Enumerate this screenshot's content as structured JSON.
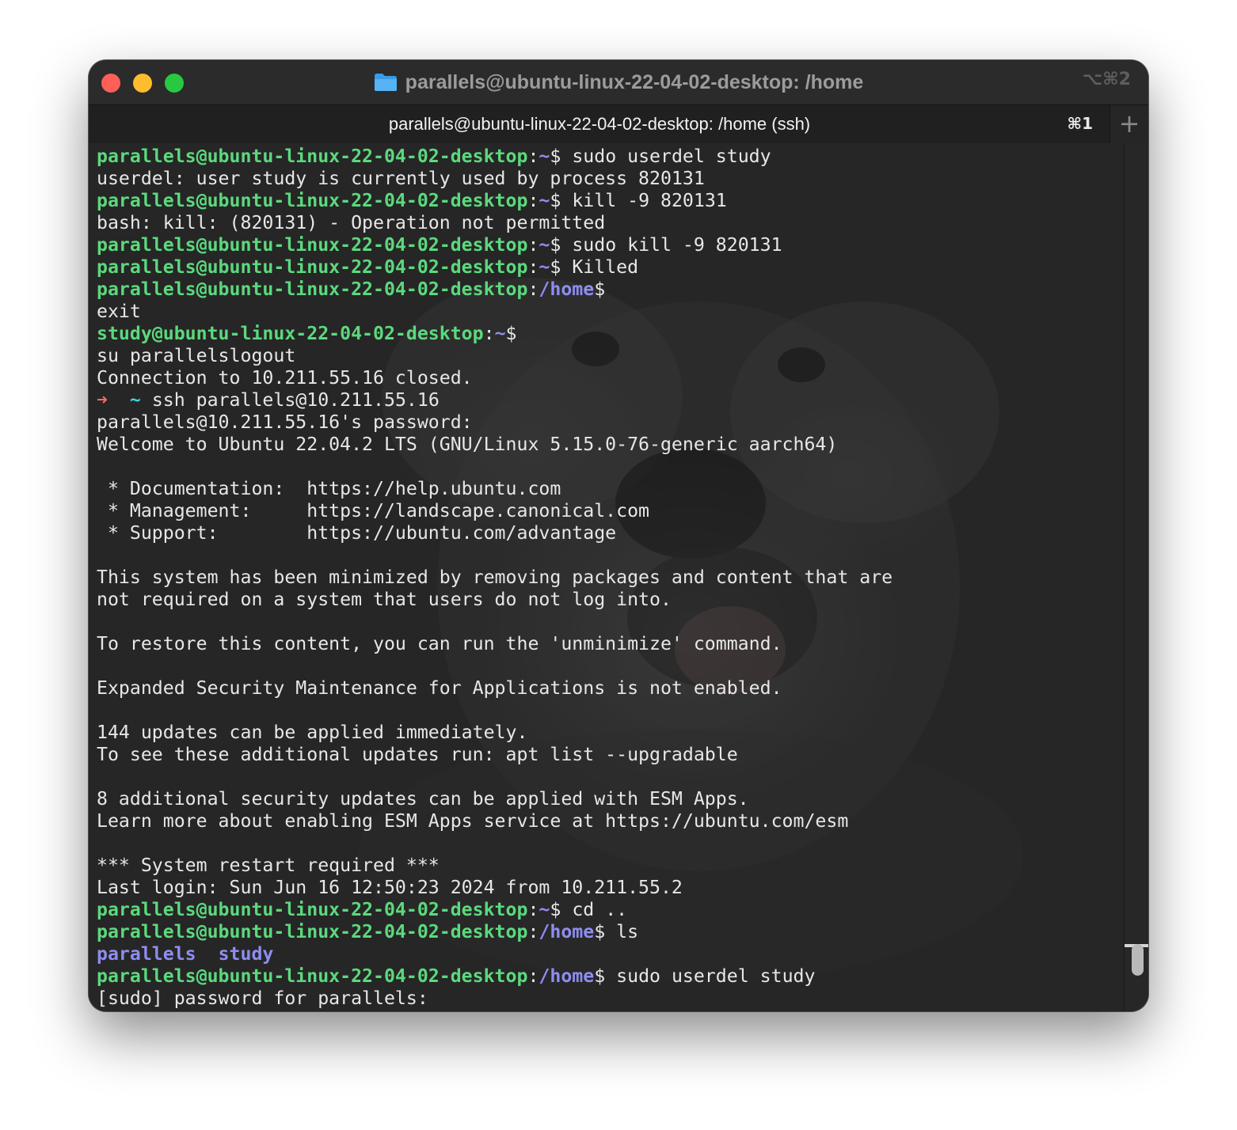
{
  "window": {
    "title": "parallels@ubuntu-linux-22-04-02-desktop: /home",
    "shortcut": "⌥⌘2"
  },
  "tab": {
    "title": "parallels@ubuntu-linux-22-04-02-desktop: /home (ssh)",
    "shortcut": "⌘1",
    "new_tab_label": "+"
  },
  "colors": {
    "prompt_user": "#5bd97d",
    "prompt_path": "#8e8df0",
    "zsh_tilde": "#3fd6e0",
    "zsh_arrow": "#f06a6a",
    "text": "#e7e7e7"
  },
  "terminal": {
    "lines": [
      {
        "user": "parallels@ubuntu-linux-22-04-02-desktop",
        "sep": ":",
        "path": "~",
        "sym": "$",
        "text": " sudo userdel study"
      },
      {
        "text": "userdel: user study is currently used by process 820131"
      },
      {
        "user": "parallels@ubuntu-linux-22-04-02-desktop",
        "sep": ":",
        "path": "~",
        "sym": "$",
        "text": " kill -9 820131"
      },
      {
        "text": "bash: kill: (820131) - Operation not permitted"
      },
      {
        "user": "parallels@ubuntu-linux-22-04-02-desktop",
        "sep": ":",
        "path": "~",
        "sym": "$",
        "text": " sudo kill -9 820131"
      },
      {
        "user": "parallels@ubuntu-linux-22-04-02-desktop",
        "sep": ":",
        "path": "~",
        "sym": "$",
        "text": " Killed"
      },
      {
        "user": "parallels@ubuntu-linux-22-04-02-desktop",
        "sep": ":",
        "path": "/home",
        "sym": "$",
        "text": ""
      },
      {
        "text": "exit"
      },
      {
        "user": "study@ubuntu-linux-22-04-02-desktop",
        "sep": ":",
        "path": "~",
        "sym": "$",
        "text": ""
      },
      {
        "text": "su parallelslogout"
      },
      {
        "text": "Connection to 10.211.55.16 closed."
      },
      {
        "zsh_arrow": "➜",
        "zsh_path": "~",
        "text": " ssh parallels@10.211.55.16"
      },
      {
        "text": "parallels@10.211.55.16's password:"
      },
      {
        "text": "Welcome to Ubuntu 22.04.2 LTS (GNU/Linux 5.15.0-76-generic aarch64)"
      },
      {
        "text": ""
      },
      {
        "text": " * Documentation:  https://help.ubuntu.com"
      },
      {
        "text": " * Management:     https://landscape.canonical.com"
      },
      {
        "text": " * Support:        https://ubuntu.com/advantage"
      },
      {
        "text": ""
      },
      {
        "text": "This system has been minimized by removing packages and content that are"
      },
      {
        "text": "not required on a system that users do not log into."
      },
      {
        "text": ""
      },
      {
        "text": "To restore this content, you can run the 'unminimize' command."
      },
      {
        "text": ""
      },
      {
        "text": "Expanded Security Maintenance for Applications is not enabled."
      },
      {
        "text": ""
      },
      {
        "text": "144 updates can be applied immediately."
      },
      {
        "text": "To see these additional updates run: apt list --upgradable"
      },
      {
        "text": ""
      },
      {
        "text": "8 additional security updates can be applied with ESM Apps."
      },
      {
        "text": "Learn more about enabling ESM Apps service at https://ubuntu.com/esm"
      },
      {
        "text": ""
      },
      {
        "text": "*** System restart required ***"
      },
      {
        "text": "Last login: Sun Jun 16 12:50:23 2024 from 10.211.55.2"
      },
      {
        "user": "parallels@ubuntu-linux-22-04-02-desktop",
        "sep": ":",
        "path": "~",
        "sym": "$",
        "text": " cd .."
      },
      {
        "user": "parallels@ubuntu-linux-22-04-02-desktop",
        "sep": ":",
        "path": "/home",
        "sym": "$",
        "text": " ls"
      },
      {
        "dirs": [
          "parallels",
          "study"
        ]
      },
      {
        "user": "parallels@ubuntu-linux-22-04-02-desktop",
        "sep": ":",
        "path": "/home",
        "sym": "$",
        "text": " sudo userdel study"
      },
      {
        "text": "[sudo] password for parallels:"
      }
    ]
  }
}
